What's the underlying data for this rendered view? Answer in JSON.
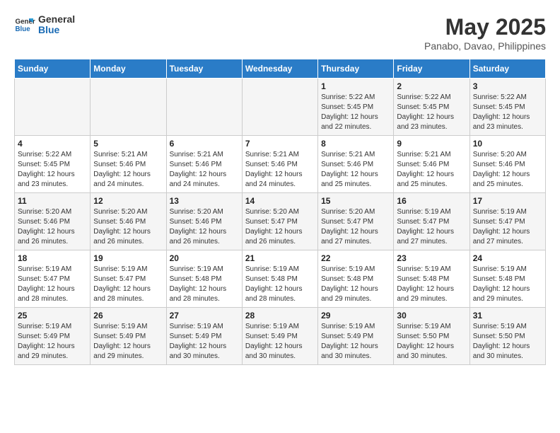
{
  "header": {
    "logo_line1": "General",
    "logo_line2": "Blue",
    "month": "May 2025",
    "location": "Panabo, Davao, Philippines"
  },
  "weekdays": [
    "Sunday",
    "Monday",
    "Tuesday",
    "Wednesday",
    "Thursday",
    "Friday",
    "Saturday"
  ],
  "weeks": [
    [
      {
        "day": "",
        "info": ""
      },
      {
        "day": "",
        "info": ""
      },
      {
        "day": "",
        "info": ""
      },
      {
        "day": "",
        "info": ""
      },
      {
        "day": "1",
        "info": "Sunrise: 5:22 AM\nSunset: 5:45 PM\nDaylight: 12 hours\nand 22 minutes."
      },
      {
        "day": "2",
        "info": "Sunrise: 5:22 AM\nSunset: 5:45 PM\nDaylight: 12 hours\nand 23 minutes."
      },
      {
        "day": "3",
        "info": "Sunrise: 5:22 AM\nSunset: 5:45 PM\nDaylight: 12 hours\nand 23 minutes."
      }
    ],
    [
      {
        "day": "4",
        "info": "Sunrise: 5:22 AM\nSunset: 5:45 PM\nDaylight: 12 hours\nand 23 minutes."
      },
      {
        "day": "5",
        "info": "Sunrise: 5:21 AM\nSunset: 5:46 PM\nDaylight: 12 hours\nand 24 minutes."
      },
      {
        "day": "6",
        "info": "Sunrise: 5:21 AM\nSunset: 5:46 PM\nDaylight: 12 hours\nand 24 minutes."
      },
      {
        "day": "7",
        "info": "Sunrise: 5:21 AM\nSunset: 5:46 PM\nDaylight: 12 hours\nand 24 minutes."
      },
      {
        "day": "8",
        "info": "Sunrise: 5:21 AM\nSunset: 5:46 PM\nDaylight: 12 hours\nand 25 minutes."
      },
      {
        "day": "9",
        "info": "Sunrise: 5:21 AM\nSunset: 5:46 PM\nDaylight: 12 hours\nand 25 minutes."
      },
      {
        "day": "10",
        "info": "Sunrise: 5:20 AM\nSunset: 5:46 PM\nDaylight: 12 hours\nand 25 minutes."
      }
    ],
    [
      {
        "day": "11",
        "info": "Sunrise: 5:20 AM\nSunset: 5:46 PM\nDaylight: 12 hours\nand 26 minutes."
      },
      {
        "day": "12",
        "info": "Sunrise: 5:20 AM\nSunset: 5:46 PM\nDaylight: 12 hours\nand 26 minutes."
      },
      {
        "day": "13",
        "info": "Sunrise: 5:20 AM\nSunset: 5:46 PM\nDaylight: 12 hours\nand 26 minutes."
      },
      {
        "day": "14",
        "info": "Sunrise: 5:20 AM\nSunset: 5:47 PM\nDaylight: 12 hours\nand 26 minutes."
      },
      {
        "day": "15",
        "info": "Sunrise: 5:20 AM\nSunset: 5:47 PM\nDaylight: 12 hours\nand 27 minutes."
      },
      {
        "day": "16",
        "info": "Sunrise: 5:19 AM\nSunset: 5:47 PM\nDaylight: 12 hours\nand 27 minutes."
      },
      {
        "day": "17",
        "info": "Sunrise: 5:19 AM\nSunset: 5:47 PM\nDaylight: 12 hours\nand 27 minutes."
      }
    ],
    [
      {
        "day": "18",
        "info": "Sunrise: 5:19 AM\nSunset: 5:47 PM\nDaylight: 12 hours\nand 28 minutes."
      },
      {
        "day": "19",
        "info": "Sunrise: 5:19 AM\nSunset: 5:47 PM\nDaylight: 12 hours\nand 28 minutes."
      },
      {
        "day": "20",
        "info": "Sunrise: 5:19 AM\nSunset: 5:48 PM\nDaylight: 12 hours\nand 28 minutes."
      },
      {
        "day": "21",
        "info": "Sunrise: 5:19 AM\nSunset: 5:48 PM\nDaylight: 12 hours\nand 28 minutes."
      },
      {
        "day": "22",
        "info": "Sunrise: 5:19 AM\nSunset: 5:48 PM\nDaylight: 12 hours\nand 29 minutes."
      },
      {
        "day": "23",
        "info": "Sunrise: 5:19 AM\nSunset: 5:48 PM\nDaylight: 12 hours\nand 29 minutes."
      },
      {
        "day": "24",
        "info": "Sunrise: 5:19 AM\nSunset: 5:48 PM\nDaylight: 12 hours\nand 29 minutes."
      }
    ],
    [
      {
        "day": "25",
        "info": "Sunrise: 5:19 AM\nSunset: 5:49 PM\nDaylight: 12 hours\nand 29 minutes."
      },
      {
        "day": "26",
        "info": "Sunrise: 5:19 AM\nSunset: 5:49 PM\nDaylight: 12 hours\nand 29 minutes."
      },
      {
        "day": "27",
        "info": "Sunrise: 5:19 AM\nSunset: 5:49 PM\nDaylight: 12 hours\nand 30 minutes."
      },
      {
        "day": "28",
        "info": "Sunrise: 5:19 AM\nSunset: 5:49 PM\nDaylight: 12 hours\nand 30 minutes."
      },
      {
        "day": "29",
        "info": "Sunrise: 5:19 AM\nSunset: 5:49 PM\nDaylight: 12 hours\nand 30 minutes."
      },
      {
        "day": "30",
        "info": "Sunrise: 5:19 AM\nSunset: 5:50 PM\nDaylight: 12 hours\nand 30 minutes."
      },
      {
        "day": "31",
        "info": "Sunrise: 5:19 AM\nSunset: 5:50 PM\nDaylight: 12 hours\nand 30 minutes."
      }
    ]
  ]
}
